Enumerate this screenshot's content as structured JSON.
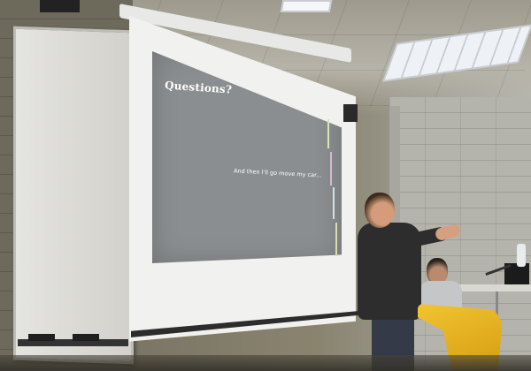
{
  "slide": {
    "title": "Questions?",
    "body": "And then I'll go move my car...",
    "progress_bar_colors": [
      "#d7e6b7",
      "#d9b6cf",
      "#d2dfe6",
      "#d8dcb3"
    ]
  },
  "colors": {
    "slide_background": "#8b8e90",
    "screen": "#f1f1ef",
    "chair": "#f0c431"
  }
}
